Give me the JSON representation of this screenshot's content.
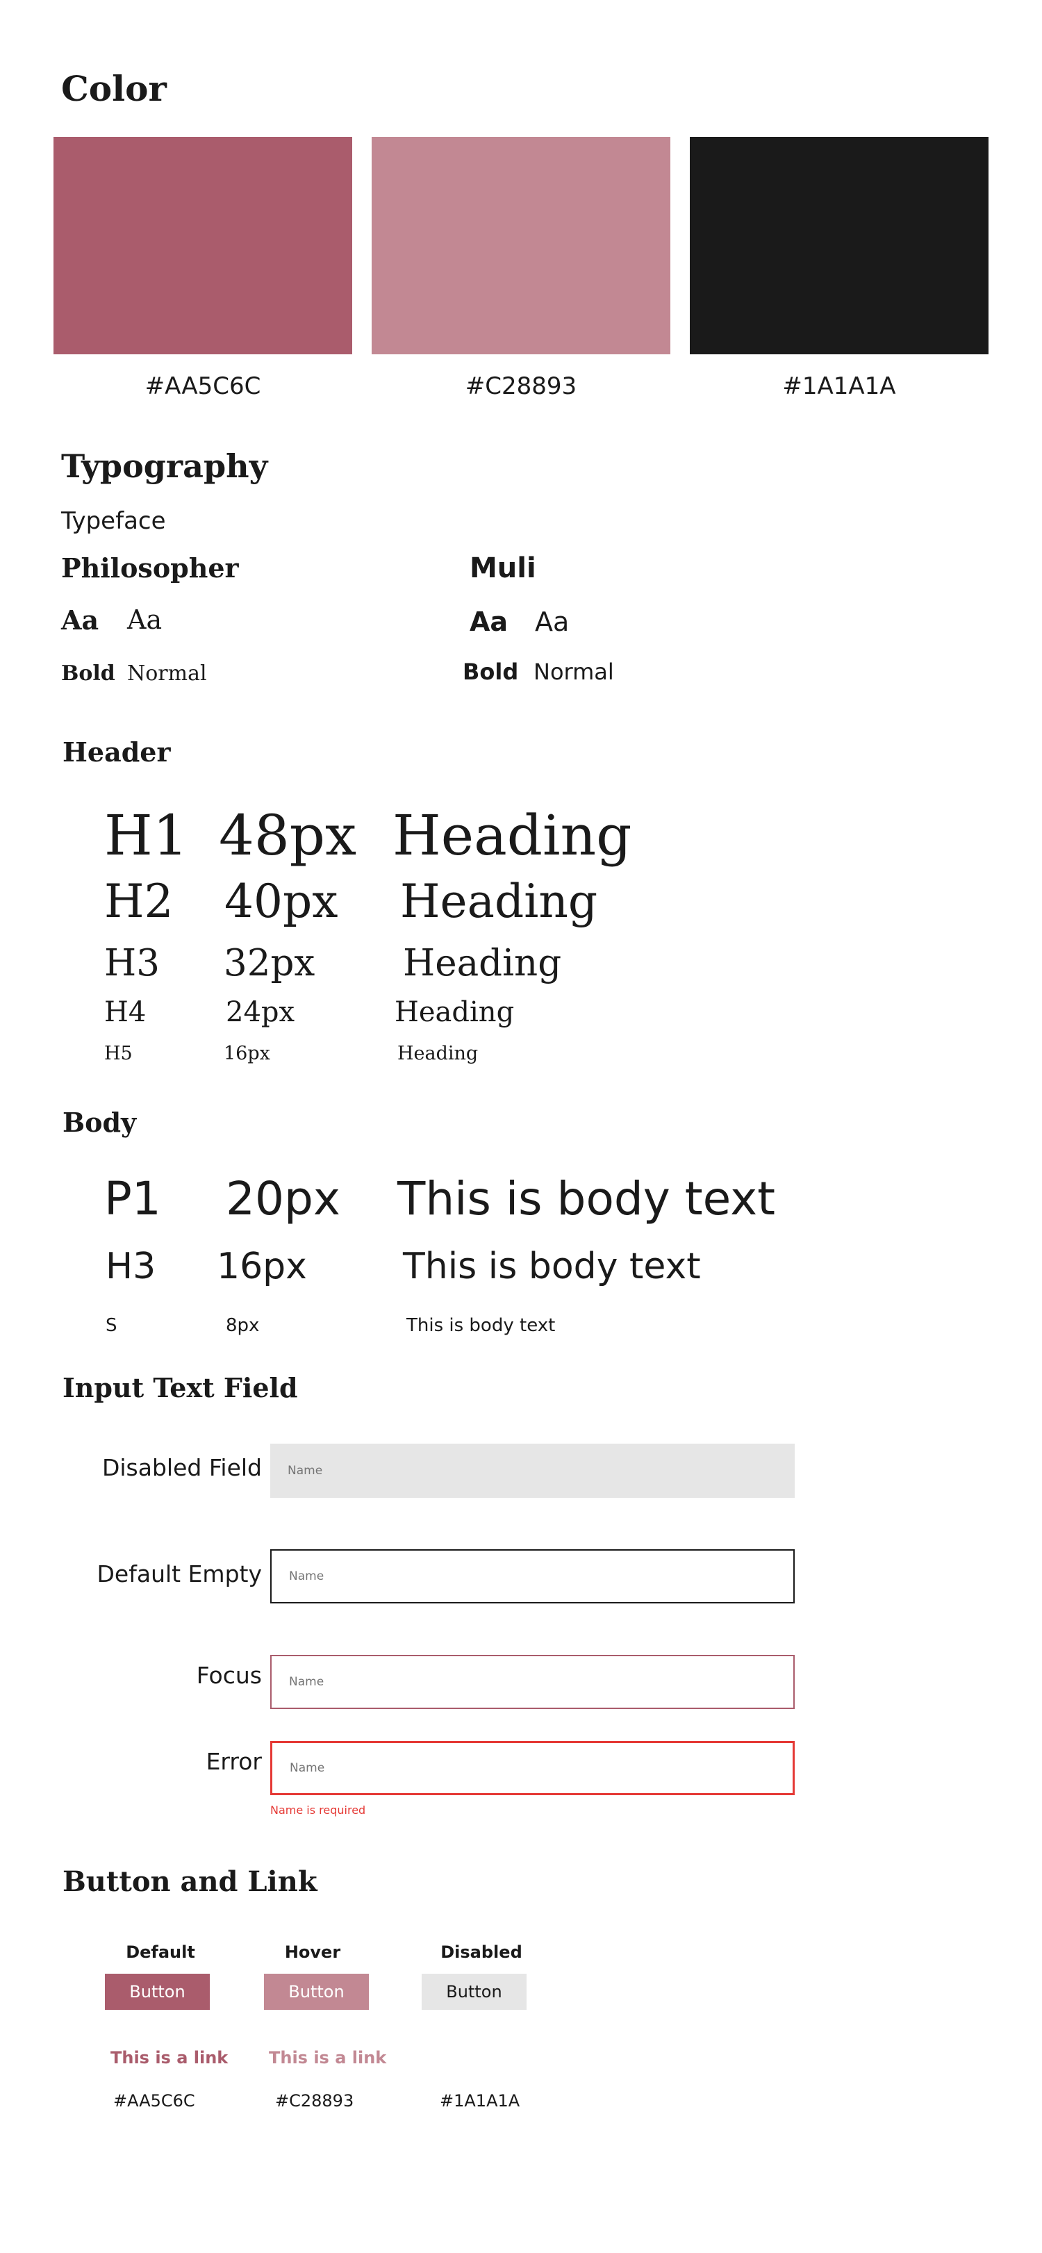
{
  "color": {
    "title": "Color",
    "swatches": [
      {
        "hex": "#AA5C6C",
        "label": "#AA5C6C"
      },
      {
        "hex": "#C28893",
        "label": "#C28893"
      },
      {
        "hex": "#1A1A1A",
        "label": "#1A1A1A"
      }
    ]
  },
  "typography": {
    "title": "Typography",
    "typeface_label": "Typeface",
    "fonts": [
      {
        "name": "Philosopher",
        "sample_bold": "Aa",
        "sample_normal": "Aa",
        "bold_label": "Bold",
        "normal_label": "Normal"
      },
      {
        "name": "Muli",
        "sample_bold": "Aa",
        "sample_normal": "Aa",
        "bold_label": "Bold",
        "normal_label": "Normal"
      }
    ]
  },
  "header": {
    "title": "Header",
    "rows": [
      {
        "tag": "H1",
        "size": "48px",
        "sample": "Heading"
      },
      {
        "tag": "H2",
        "size": "40px",
        "sample": "Heading"
      },
      {
        "tag": "H3",
        "size": "32px",
        "sample": "Heading"
      },
      {
        "tag": "H4",
        "size": "24px",
        "sample": "Heading"
      },
      {
        "tag": "H5",
        "size": "16px",
        "sample": "Heading"
      }
    ]
  },
  "body": {
    "title": "Body",
    "rows": [
      {
        "tag": "P1",
        "size": "20px",
        "sample": "This is body text"
      },
      {
        "tag": "H3",
        "size": "16px",
        "sample": "This is body text"
      },
      {
        "tag": "S",
        "size": "8px",
        "sample": "This is body text"
      }
    ]
  },
  "input": {
    "title": "Input Text Field",
    "fields": [
      {
        "label": "Disabled Field",
        "placeholder": "Name"
      },
      {
        "label": "Default Empty",
        "placeholder": "Name"
      },
      {
        "label": "Focus",
        "placeholder": "Name"
      },
      {
        "label": "Error",
        "placeholder": "Name",
        "error": "Name is required"
      }
    ]
  },
  "buttons": {
    "title": "Button and Link",
    "states": [
      {
        "state": "Default",
        "label": "Button",
        "link": "This is a link",
        "code": "#AA5C6C"
      },
      {
        "state": "Hover",
        "label": "Button",
        "link": "This is a link",
        "code": "#C28893"
      },
      {
        "state": "Disabled",
        "label": "Button",
        "code": "#1A1A1A"
      }
    ]
  },
  "palette": {
    "primary": "#AA5C6C",
    "hover": "#C28893",
    "dark": "#1A1A1A",
    "disabled": "#E6E6E6",
    "error": "#E53935"
  }
}
